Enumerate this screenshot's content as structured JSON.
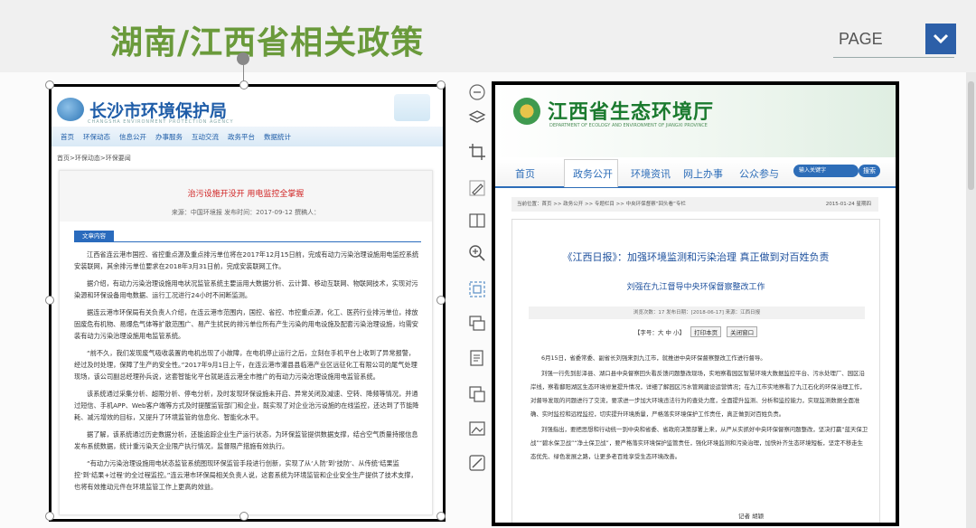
{
  "header": {
    "title": "湖南/江西省相关政策",
    "page_label": "PAGE",
    "title_color": "#6a9a3b",
    "accent_color": "#2c5fa8"
  },
  "left_doc": {
    "site_name": "长沙市环境保护局",
    "site_sub": "CHANGSHA ENVIRONMENT PROTECTION AGENCY",
    "nav": [
      "首页",
      "环保动态",
      "信息公开",
      "办事服务",
      "互动交流",
      "政务平台",
      "数据统计"
    ],
    "breadcrumb": "首页>环保动态>环保要闻",
    "article_title": "治污设施开没开 用电监控全掌握",
    "meta": "来源：中国环境报    发布时间：2017-09-12    撰稿人：",
    "section_tag": "文章内容",
    "paragraphs": [
      "江西省连云港市国控、省控重点源及重点排污单位将在2017年12月15日前，完成有动力污染治理设施用电监控系统安装联网，其余排污单位要求在2018年3月31日前，完成安装联网工作。",
      "据介绍，有动力污染治理设施用电状况监管系统主要运用大数据分析、云计算、移动互联网、物联网技术，实现对污染源和环保设备用电数据、运行工况进行24小时不间断监测。",
      "据连云港市环保局有关负责人介绍，在连云港市范围内，国控、省控、市控重点源，化工、医药行业排污单位，排放固废危有机物、易爆危气体等扩散范围广、易产生扰民的排污单位所有产生污染的用电设施及配套污染治理设施，均需安装有动力污染治理设施用电监管系统。",
      "“前不久，我们发现废气吸收装置的电机出现了小故障，在电机停止运行之后，立刻在手机平台上收到了异常报警，经过及时处理，保障了生产的安全性。”2017年9月1日上午，在连云港市灌县县临港产业区远征化工有限公司的尾气处理现场，该公司副总经理孙兵说，这套智能化平台就是连云港全市推广的有动力污染治理设施用电监管系统。",
      "该系统通过采集分析、超限分析、停电分析，及时发现环保设施未开启、异常关闭及减速、空转、降频等情况，并通过短信、手机APP、Web客户端等方式及时提醒监管部门和企业，既实现了对企业治污设施的在线监控，还达到了节能降耗、减污增效的目标，又提升了环境监管的信息化、智能化水平。",
      "据了解，该系统通过历史数据分析，还能追踪企业生产运行状态，为环保监管提供数据支撑，结合空气质量持报信息发布系统数据，统计重污染天企业限产执行情况，监督限产措施有效执行。",
      "“有动力污染治理设施用电状态监管系统图现环保监管手段进行创新，实现了从‘人防’到‘技防’、从传统‘结果监控’到‘结果+过程’的全过程监控。”连云港市环保局相关负责人说，这套系统为环境监管和企业安全生产提供了技术支撑，也将有效推动元件在环境监管工作上更高的效益。"
    ]
  },
  "right_doc": {
    "site_name": "江西省生态环境厅",
    "site_sub": "DEPARTMENT OF ECOLOGY AND ENVIRONMENT OF JIANGXI PROVINCE",
    "nav": [
      "首页",
      "政务公开",
      "环境资讯",
      "网上办事",
      "公众参与"
    ],
    "search_placeholder": "输入关键字",
    "search_button": "搜索",
    "breadcrumb": "当前位置：首页 >> 政务公开 >> 专题栏目 >> 中央环保督察“回头看”专栏",
    "bread_date": "2015-01-24 星期四",
    "article_title": "《江西日报》：加强环境监测和污染治理 真正做到对百姓负责",
    "article_sub": "刘强在九江督导中央环保督察整改工作",
    "meta": "浏览次数：17        发布日期：[2018-06-17]        来源：江西日报",
    "font_size_label": "【字号：大 中 小】",
    "print_label": "打印本页",
    "close_label": "关闭窗口",
    "paragraphs": [
      "6月15日，省委常委、副省长刘强来到九江市，就推进中央环保督察整改工作进行督导。",
      "刘强一行先到彭泽县、湖口县中央督察回头看反馈问题整改现场，实地察看园区智慧环境大数据监控平台、污水处理厂、园区沿岸线，察看鄱阳湖区生态环境修复提升情况，详细了解园区污水管网建设运营情况；在九江市实地察看了九江石化的环保治理工作，对督导发现的问题进行了交流，要求进一步加大环境违法行为的查处力度，全面提升监测、分析和监控能力，实现监测数据全面准确、实时监控和远程监控，切实提升环境质量，严格落实环境保护工作责任，真正做到对百姓负责。",
      "刘强指出，要把思想和行动统一到中央和省委、省政府决策部署上来，从严从实抓好中央环保督察问题整改，坚决打赢“蓝天保卫战”“碧水保卫战”“净土保卫战”，要严格落实环境保护监管责任，强化环境监测和污染治理，加快补齐生态环境短板，坚定不移走生态优先、绿色发展之路，让更多老百姓享受生态环境改善。"
    ],
    "signature": "记者 胡颖"
  }
}
